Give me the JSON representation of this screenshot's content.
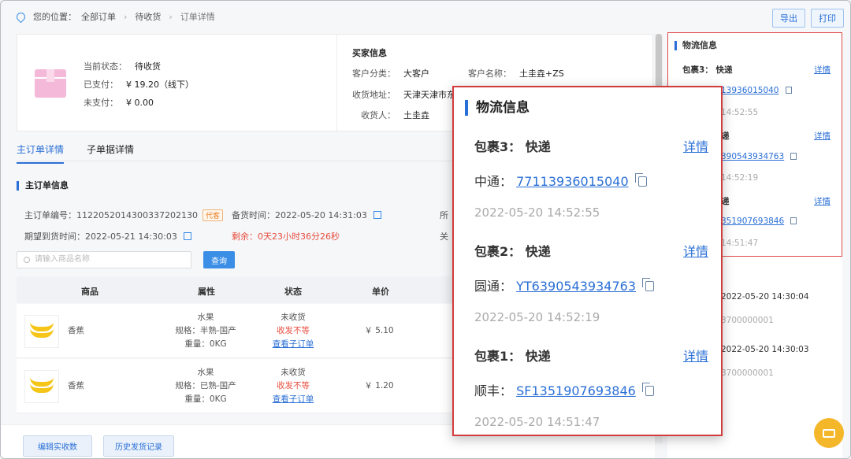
{
  "breadcrumb": {
    "prefix": "您的位置：",
    "items": [
      "全部订单",
      "待收货",
      "订单详情"
    ]
  },
  "toolbar": {
    "export_label": "导出",
    "print_label": "打印"
  },
  "summary": {
    "status_label": "当前状态：",
    "status_value": "待收货",
    "paid_label": "已支付：",
    "paid_value": "¥ 19.20（线下）",
    "unpaid_label": "未支付：",
    "unpaid_value": "¥ 0.00",
    "buyer_title": "买家信息",
    "cust_type_label": "客户分类：",
    "cust_type_value": "大客户",
    "cust_name_label": "客户名称：",
    "cust_name_value": "土圭垚+ZS",
    "address_label": "收货地址：",
    "address_value": "天津天津市东丽",
    "receiver_label": "收货人：",
    "receiver_value": "土圭垚"
  },
  "tabs": [
    "主订单详情",
    "子单据详情"
  ],
  "main_order": {
    "title": "主订单信息",
    "order_no": "主订单编号：11220520143003372021 30",
    "order_no_text": "主订单编号：1122052014300337202130",
    "tag": "代客",
    "prep_time": "备货时间：2022-05-20 14:31:03",
    "expect_time": "期望到货时间：2022-05-21 14:30:03",
    "remaining": "剩余：0天23小时36分26秒",
    "cut_a": "所",
    "cut_b": "关"
  },
  "search": {
    "placeholder": "请输入商品名称",
    "button": "查询"
  },
  "table": {
    "headers": [
      "商品",
      "属性",
      "状态",
      "单价"
    ],
    "rows": [
      {
        "name": "香蕉",
        "attr1": "水果",
        "attr2": "规格：半熟-国产",
        "attr3": "重量：0KG",
        "status1": "未收货",
        "status2": "收发不等",
        "status3": "查看子订单",
        "price": "￥ 5.10"
      },
      {
        "name": "香蕉",
        "attr1": "水果",
        "attr2": "规格：已熟-国产",
        "attr3": "重量：0KG",
        "status1": "未收货",
        "status2": "收发不等",
        "status3": "查看子订单",
        "price": "￥ 1.20"
      }
    ]
  },
  "footer": {
    "edit_btn": "编辑实收数",
    "history_btn": "历史发货记录"
  },
  "right_panel": {
    "title": "物流信息",
    "pkg3": "包裹3：  快递",
    "detail": "详情",
    "pkg3_no": "13936015040",
    "pkg3_time": "14:52:55",
    "pkg2": "递",
    "pkg2_no": "390543934763",
    "pkg2_time": "14:52:19",
    "pkg1": "递",
    "pkg1_no": "351907693846",
    "pkg1_time": "14:51:47",
    "rec1_time": "2022-05-20 14:30:04",
    "rec1_no": "3700000001",
    "rec2_time": "2022-05-20 14:30:03",
    "rec2_no": "3700000001"
  },
  "popup": {
    "title": "物流信息",
    "packages": [
      {
        "label": "包裹3：  快递",
        "detail": "详情",
        "carrier": "中通：",
        "tracking": "77113936015040",
        "time": "2022-05-20 14:52:55"
      },
      {
        "label": "包裹2：  快递",
        "detail": "详情",
        "carrier": "圆通：",
        "tracking": "YT6390543934763",
        "time": "2022-05-20 14:52:19"
      },
      {
        "label": "包裹1：  快递",
        "detail": "详情",
        "carrier": "顺丰：",
        "tracking": "SF1351907693846",
        "time": "2022-05-20 14:51:47"
      }
    ]
  },
  "colors": {
    "accent": "#2a6fd6",
    "highlight_border": "#d33c3c",
    "warning": "#e74c3c"
  },
  "icons": [
    "location-pin-icon",
    "box-icon",
    "edit-icon",
    "search-icon",
    "banana-image",
    "copy-icon",
    "chat-icon"
  ]
}
